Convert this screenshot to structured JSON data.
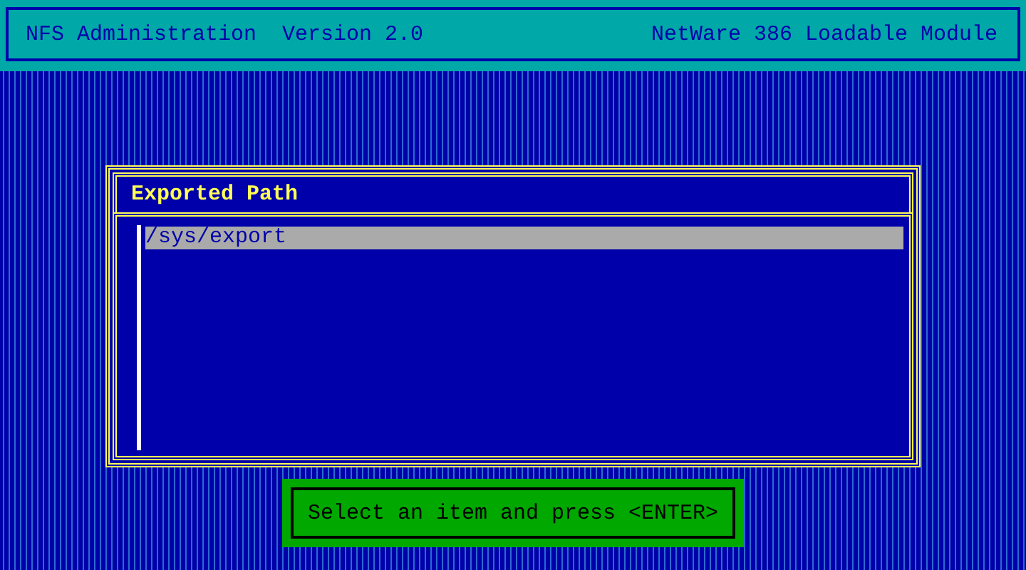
{
  "header": {
    "title": "NFS Administration  Version 2.0",
    "module": "NetWare 386 Loadable Module"
  },
  "dialog": {
    "title": "Exported Path",
    "items": [
      {
        "label": "/sys/export",
        "selected": true
      }
    ]
  },
  "status": {
    "message": "Select an item and press <ENTER>"
  }
}
